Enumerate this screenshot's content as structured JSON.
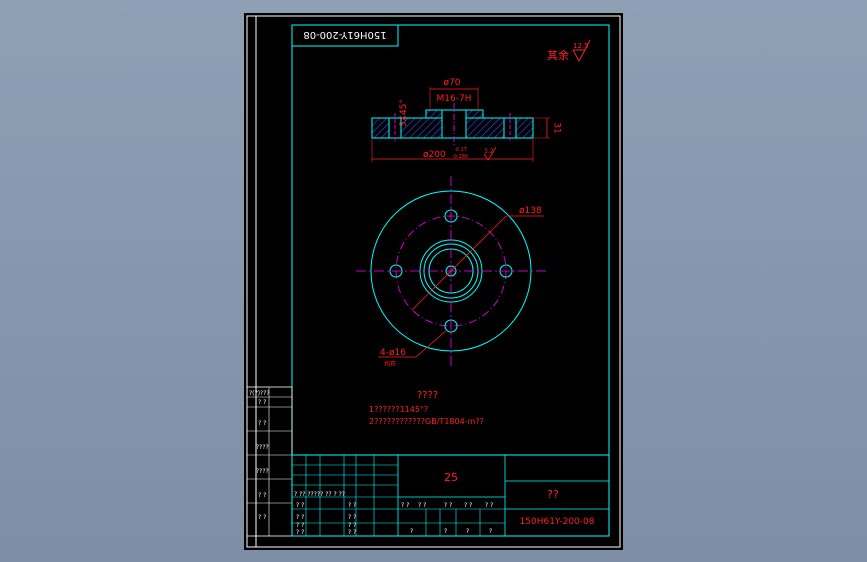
{
  "colors": {
    "background": "#000000",
    "border": "#ffffff",
    "frame": "#00ffff",
    "dimension": "#ff2020",
    "center_line": "#ff00ff",
    "part_outline": "#00ffff",
    "hatch": "#3355ff",
    "title_text": "#ff2020"
  },
  "drawing": {
    "rotated_code": "150H61Y-200-08",
    "roughness": {
      "label": "其余",
      "value": "12.5"
    },
    "section_view": {
      "dim_bore": "ø70",
      "dim_thread": "M16-7H",
      "dim_chamfer": "5X45°",
      "dim_thickness": "31",
      "dim_outer": "ø200",
      "tol_upper": "-0.17",
      "tol_lower": "-0.285",
      "roughness_small": "3.2"
    },
    "plan_view": {
      "dim_pcd": "ø138",
      "dim_holes": "4-ø16",
      "holes_note": "均布"
    },
    "notes": {
      "title": "????",
      "line1": "1??????1145°?",
      "line2": "2????????????GB/T1804-m??"
    }
  },
  "side_table": {
    "rows": [
      "?(?)???",
      "?   ?",
      "?   ?",
      "????",
      "????",
      "?    ?",
      "?    ?"
    ]
  },
  "title_block": {
    "scale_cell": "25",
    "name_cell": "??",
    "drawing_number": "150H61Y-200-08",
    "row_labels": [
      "? ?? ????? ?? ? ??",
      "? ?",
      "? ?",
      "? ?",
      "? ?"
    ],
    "sign_cells": [
      "? ?",
      "? ?",
      "? ?",
      "? ?"
    ],
    "middle_row": [
      "? ?",
      "? ?",
      "? ?",
      "? ?",
      "? ?"
    ],
    "bottom_row": [
      "?",
      "?",
      "?",
      "?"
    ]
  }
}
